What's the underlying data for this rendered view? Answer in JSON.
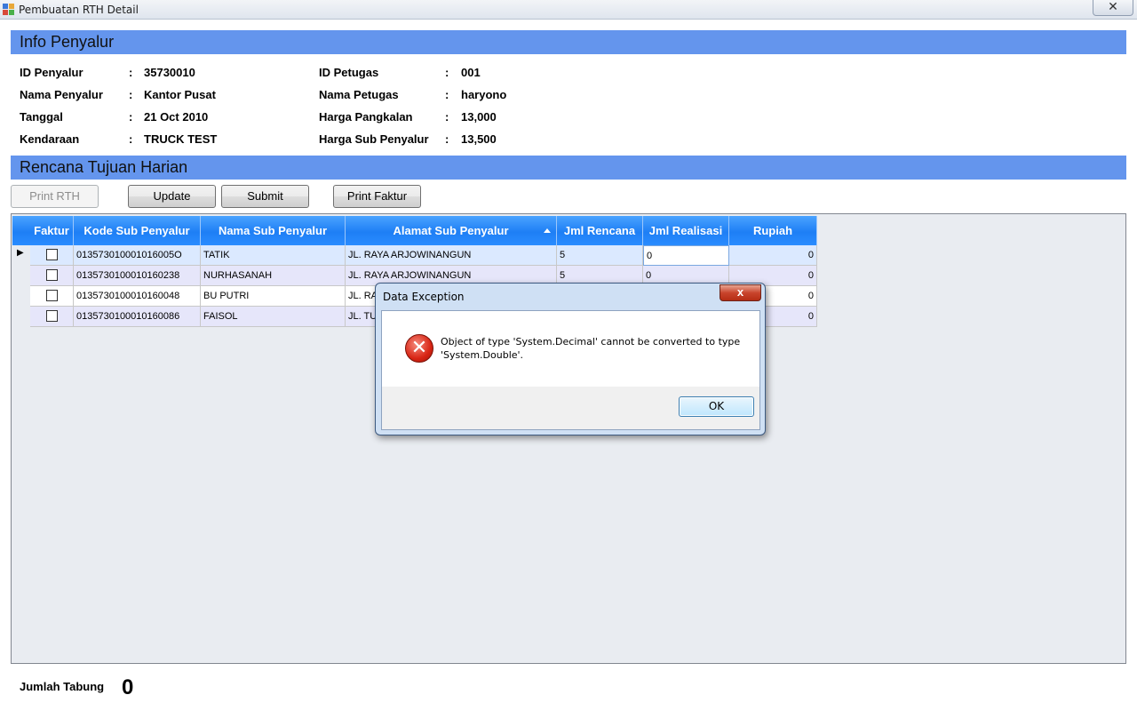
{
  "window": {
    "title": "Pembuatan RTH Detail",
    "close_glyph": "✕"
  },
  "info_section": {
    "header": "Info Penyalur",
    "left_fields": [
      {
        "label": "ID Penyalur",
        "value": "35730010"
      },
      {
        "label": "Nama Penyalur",
        "value": "Kantor Pusat"
      },
      {
        "label": "Tanggal",
        "value": "21 Oct 2010"
      },
      {
        "label": "Kendaraan",
        "value": "TRUCK TEST"
      }
    ],
    "right_fields": [
      {
        "label": "ID Petugas",
        "value": "001"
      },
      {
        "label": "Nama Petugas",
        "value": "haryono"
      },
      {
        "label": "Harga Pangkalan",
        "value": "13,000"
      },
      {
        "label": "Harga Sub Penyalur",
        "value": "13,500"
      }
    ],
    "separator": ":"
  },
  "rth_section": {
    "header": "Rencana Tujuan Harian",
    "buttons": {
      "print_rth": "Print RTH",
      "update": "Update",
      "submit": "Submit",
      "print_faktur": "Print Faktur"
    }
  },
  "grid": {
    "columns": [
      "Faktur",
      "Kode Sub Penyalur",
      "Nama Sub Penyalur",
      "Alamat Sub Penyalur",
      "Jml Rencana",
      "Jml Realisasi",
      "Rupiah"
    ],
    "sorted_column": "Alamat Sub Penyalur",
    "rows": [
      {
        "faktur": false,
        "kode": "013573010001016005O",
        "nama": "TATIK",
        "alamat": "JL. RAYA ARJOWINANGUN",
        "rencana": "5",
        "realisasi": "0",
        "rupiah": "0"
      },
      {
        "faktur": false,
        "kode": "0135730100010160238",
        "nama": "NURHASANAH",
        "alamat": "JL. RAYA ARJOWINANGUN",
        "rencana": "5",
        "realisasi": "0",
        "rupiah": "0"
      },
      {
        "faktur": false,
        "kode": "0135730100010160048",
        "nama": "BU PUTRI",
        "alamat": "JL. RA",
        "rencana": "",
        "realisasi": "",
        "rupiah": "0"
      },
      {
        "faktur": false,
        "kode": "0135730100010160086",
        "nama": "FAISOL",
        "alamat": "JL. TU",
        "rencana": "",
        "realisasi": "",
        "rupiah": "0"
      }
    ],
    "current_row_indicator": "▶"
  },
  "dialog": {
    "title": "Data Exception",
    "message": "Object of type 'System.Decimal' cannot be converted to type 'System.Double'.",
    "ok_label": "OK",
    "icon": "error-icon",
    "close_glyph": "x"
  },
  "footer": {
    "jumlah_tabung_label": "Jumlah Tabung",
    "jumlah_tabung_value": "0"
  },
  "colors": {
    "section_header": "#6495ed",
    "grid_header": "#1e7ff5",
    "selected_row": "#dbe9ff",
    "alt_row": "#e6e6fa"
  }
}
